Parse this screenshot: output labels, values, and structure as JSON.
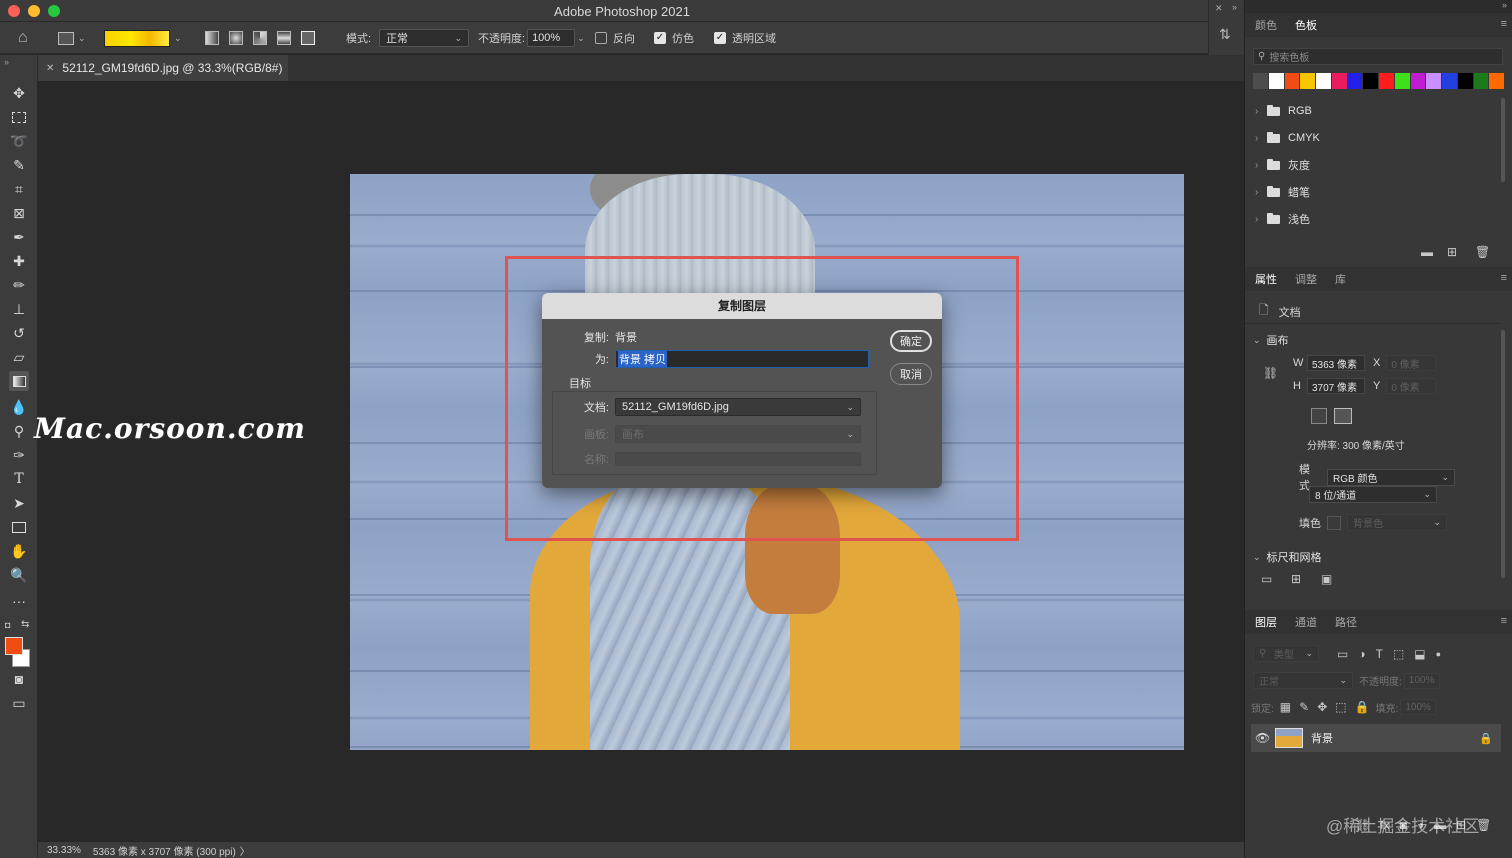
{
  "app": {
    "title": "Adobe Photoshop 2021"
  },
  "options_bar": {
    "mode_label": "模式:",
    "mode_value": "正常",
    "opacity_label": "不透明度:",
    "opacity_value": "100%",
    "reverse_label": "反向",
    "dither_label": "仿色",
    "transparency_label": "透明区域",
    "reverse_checked": false,
    "dither_checked": true,
    "transparency_checked": true
  },
  "document_tab": {
    "title": "52112_GM19fd6D.jpg @ 33.3%(RGB/8#)"
  },
  "dialog": {
    "title": "复制图层",
    "duplicate_label": "复制:",
    "duplicate_value": "背景",
    "as_label": "为:",
    "as_value": "背景 拷贝",
    "target_label": "目标",
    "document_label": "文档:",
    "document_value": "52112_GM19fd6D.jpg",
    "artboard_label": "画板:",
    "artboard_value": "画布",
    "name_label": "名称:",
    "ok_label": "确定",
    "cancel_label": "取消"
  },
  "watermarks": {
    "site": "Mac.orsoon.com",
    "community": "@稀土掘金技术社区"
  },
  "status_bar": {
    "zoom": "33.33%",
    "info": "5363 像素 x 3707 像素 (300 ppi)",
    "arrow": "〉"
  },
  "swatches_panel": {
    "tabs": [
      "颜色",
      "色板"
    ],
    "active_tab": 1,
    "search_placeholder": "搜索色板",
    "colors": [
      "#4d4d4d",
      "#ffffff",
      "#f04d14",
      "#f7c600",
      "#ffffff",
      "#e81c5e",
      "#2020e8",
      "#000000",
      "#ff1c1c",
      "#3ee01c",
      "#c01cd0",
      "#c890ff",
      "#2040e0",
      "#000000",
      "#1c7a1c",
      "#ff6a00"
    ],
    "groups": [
      "RGB",
      "CMYK",
      "灰度",
      "蜡笔",
      "浅色"
    ]
  },
  "properties_panel": {
    "tabs": [
      "属性",
      "调整",
      "库"
    ],
    "active_tab": 0,
    "doc_label": "文档",
    "canvas_header": "画布",
    "w_label": "W",
    "w_value": "5363 像素",
    "h_label": "H",
    "h_value": "3707 像素",
    "x_label": "X",
    "x_value": "0 像素",
    "y_label": "Y",
    "y_value": "0 像素",
    "resolution": "分辨率: 300 像素/英寸",
    "mode_label": "模式",
    "mode_value": "RGB 颜色",
    "depth_value": "8 位/通道",
    "fill_label": "填色",
    "fill_value": "背景色",
    "rulers_header": "标尺和网格"
  },
  "layers_panel": {
    "tabs": [
      "图层",
      "通道",
      "路径"
    ],
    "active_tab": 0,
    "filter_placeholder": "类型",
    "blend_mode": "正常",
    "opacity_label": "不透明度:",
    "opacity_value": "100%",
    "lock_label": "锁定:",
    "fill_label": "填充:",
    "fill_value": "100%",
    "layer_name": "背景"
  },
  "icons": {
    "tools": [
      "move-icon",
      "marquee-icon",
      "lasso-icon",
      "quick-select-icon",
      "crop-icon",
      "frame-icon",
      "eyedropper-icon",
      "healing-icon",
      "brush-icon",
      "stamp-icon",
      "history-brush-icon",
      "eraser-icon",
      "gradient-icon",
      "blur-icon",
      "dodge-icon",
      "pen-icon",
      "type-icon",
      "path-select-icon",
      "rectangle-icon",
      "hand-icon",
      "zoom-icon",
      "more-tools-icon"
    ]
  },
  "colors": {
    "foreground": "#f04d14",
    "background": "#ffffff",
    "highlight": "#e0544f",
    "accent": "#2b63c9"
  }
}
